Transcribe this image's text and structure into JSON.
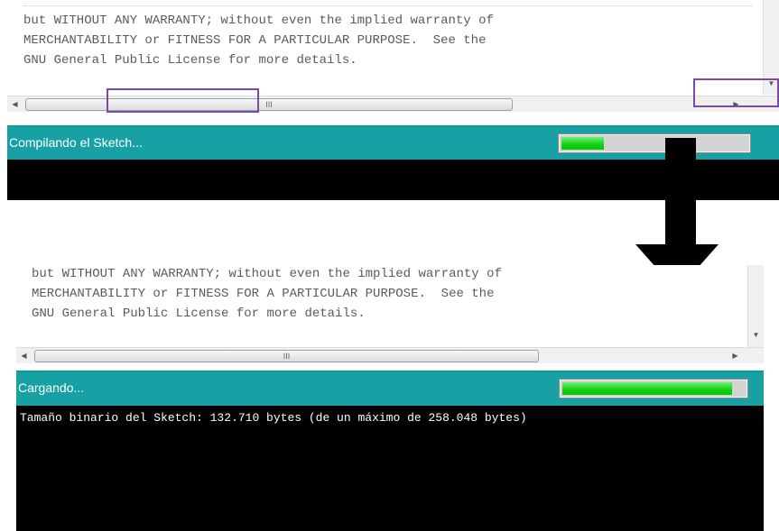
{
  "license_text": {
    "lines": [
      "but WITHOUT ANY WARRANTY; without even the implied warranty of",
      "MERCHANTABILITY or FITNESS FOR A PARTICULAR PURPOSE.  See the",
      "GNU General Public License for more details."
    ]
  },
  "scrollbar": {
    "grip": "III"
  },
  "before": {
    "status_text": "Compilando el Sketch...",
    "progress": 0.23,
    "console_text": ""
  },
  "after": {
    "status_text": "Cargando...",
    "progress": 0.93,
    "console_text": "Tamaño binario del Sketch: 132.710 bytes (de un máximo de 258.048 bytes)"
  },
  "colors": {
    "status_bar": "#17a1a5",
    "progress_fill": "#12d012",
    "highlight_box": "#7a4aa6",
    "console_bg": "#000000"
  }
}
